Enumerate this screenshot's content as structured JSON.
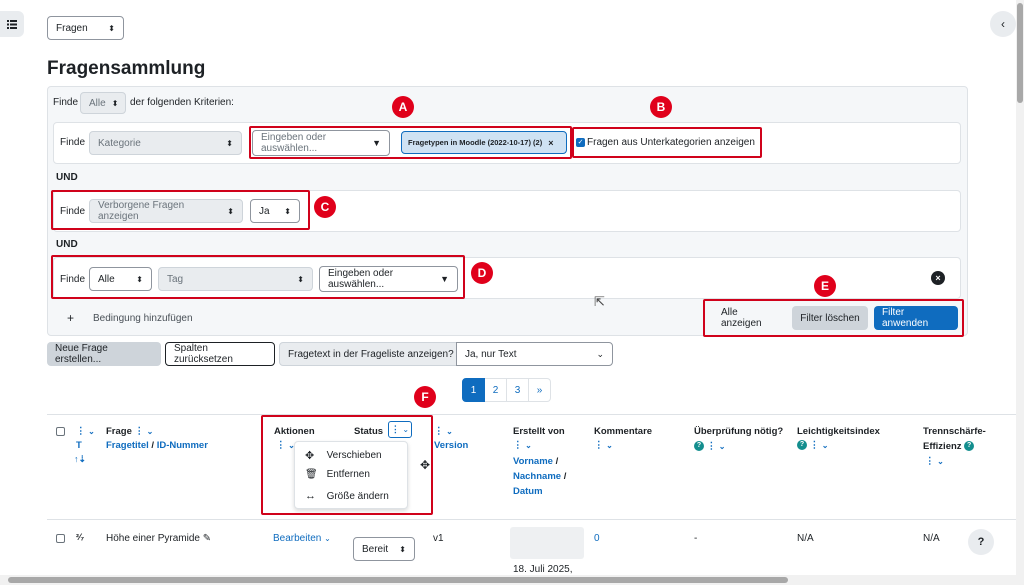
{
  "left_drawer_icon": "list-icon",
  "right_drawer_icon": "chevron-left-icon",
  "nav_select": "Fragen",
  "page_title": "Fragensammlung",
  "filter": {
    "top_find": "Finde",
    "top_mode": "Alle",
    "top_suffix": "der folgenden Kriterien:",
    "row1": {
      "find": "Finde",
      "type": "Kategorie",
      "input_placeholder": "Eingeben oder auswählen...",
      "chip": "Fragetypen in Moodle (2022-10-17) (2)",
      "subcat_label": "Fragen aus Unterkategorien anzeigen"
    },
    "and1": "UND",
    "row2": {
      "find": "Finde",
      "type": "Verborgene Fragen anzeigen",
      "value": "Ja"
    },
    "and2": "UND",
    "row3": {
      "find": "Finde",
      "mode": "Alle",
      "type": "Tag",
      "input_placeholder": "Eingeben oder auswählen..."
    },
    "add_condition": "Bedingung hinzufügen",
    "show_all": "Alle anzeigen",
    "clear": "Filter löschen",
    "apply": "Filter anwenden"
  },
  "markers": [
    "A",
    "B",
    "C",
    "D",
    "E",
    "F"
  ],
  "toolbar": {
    "new_question": "Neue Frage erstellen...",
    "reset_columns": "Spalten zurücksetzen",
    "show_text_label": "Fragetext in der Frageliste anzeigen?",
    "show_text_value": "Ja, nur Text"
  },
  "pagination": {
    "pages": [
      "1",
      "2",
      "3"
    ],
    "next": "»",
    "current": "1"
  },
  "table": {
    "headers": {
      "type": "T",
      "question": "Frage",
      "question_title": "Fragetitel",
      "question_sep": "/",
      "question_id": "ID-Nummer",
      "actions": "Aktionen",
      "status": "Status",
      "version": "Version",
      "created_by": "Erstellt von",
      "first_name": "Vorname",
      "last_name": "Nachname",
      "date": "Datum",
      "comments": "Kommentare",
      "review": "Überprüfung nötig?",
      "facility": "Leichtigkeitsindex",
      "discrimination_1": "Trennschärfe-",
      "discrimination_2": "Effizienz"
    },
    "column_menu": [
      "Verschieben",
      "Entfernen",
      "Größe ändern"
    ],
    "rows": [
      {
        "name": "Höhe einer Pyramide",
        "action": "Bearbeiten",
        "status": "Bereit",
        "version": "v1",
        "created": "18. Juli 2025,",
        "comments": "0",
        "review": "-",
        "facility": "N/A",
        "discrimination": "N/A"
      }
    ]
  },
  "help_button": "?"
}
